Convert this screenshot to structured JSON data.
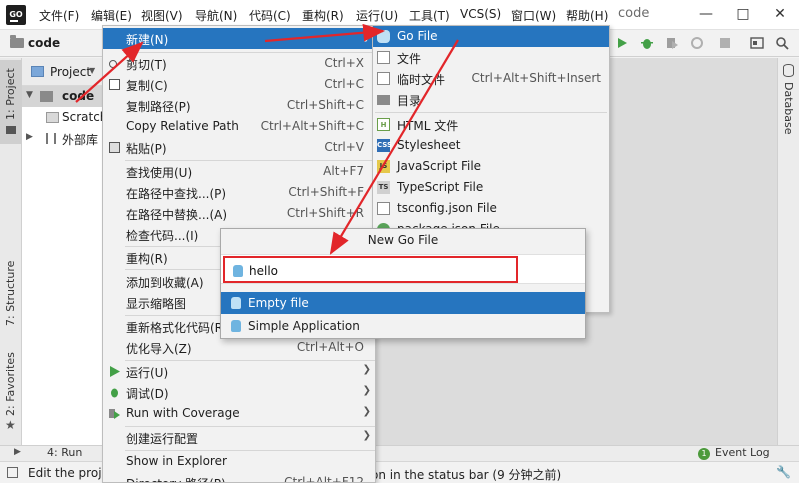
{
  "menubar": {
    "logo": "GO",
    "items": [
      "文件(F)",
      "编辑(E)",
      "视图(V)",
      "导航(N)",
      "代码(C)",
      "重构(R)",
      "运行(U)",
      "工具(T)",
      "VCS(S)",
      "窗口(W)",
      "帮助(H)"
    ],
    "window_title": "code"
  },
  "toolbar": {
    "project_name": "code"
  },
  "left_strip": {
    "tab_project": "1: Project",
    "tab_structure": "7: Structure",
    "tab_favorites": "2: Favorites"
  },
  "right_strip": {
    "tab_database": "Database"
  },
  "project_panel": {
    "header_label": "Project",
    "tree": [
      {
        "label": "code",
        "icon": "folder-icon"
      },
      {
        "label": "Scratch",
        "icon": "scratch-icon"
      },
      {
        "label": "外部库",
        "icon": "library-icon"
      }
    ]
  },
  "context_menu": {
    "items": [
      {
        "label": "新建(N)",
        "shortcut": ""
      },
      {
        "label": "剪切(T)",
        "shortcut": "Ctrl+X"
      },
      {
        "label": "复制(C)",
        "shortcut": "Ctrl+C"
      },
      {
        "label": "复制路径(P)",
        "shortcut": "Ctrl+Shift+C"
      },
      {
        "label": "Copy Relative Path",
        "shortcut": "Ctrl+Alt+Shift+C"
      },
      {
        "label": "粘贴(P)",
        "shortcut": "Ctrl+V"
      },
      {
        "label": "查找使用(U)",
        "shortcut": "Alt+F7"
      },
      {
        "label": "在路径中查找...(P)",
        "shortcut": "Ctrl+Shift+F"
      },
      {
        "label": "在路径中替换...(A)",
        "shortcut": "Ctrl+Shift+R"
      },
      {
        "label": "检查代码...(I)",
        "shortcut": ""
      },
      {
        "label": "重构(R)",
        "shortcut": ""
      },
      {
        "label": "添加到收藏(A)",
        "shortcut": ""
      },
      {
        "label": "显示缩略图",
        "shortcut": ""
      },
      {
        "label": "重新格式化代码(R)",
        "shortcut": ""
      },
      {
        "label": "优化导入(Z)",
        "shortcut": "Ctrl+Alt+O"
      },
      {
        "label": "运行(U)",
        "shortcut": ""
      },
      {
        "label": "调试(D)",
        "shortcut": ""
      },
      {
        "label": "Run with Coverage",
        "shortcut": ""
      },
      {
        "label": "创建运行配置",
        "shortcut": ""
      },
      {
        "label": "Show in Explorer",
        "shortcut": ""
      },
      {
        "label": "Directory 路径(P)",
        "shortcut": "Ctrl+Alt+F12"
      }
    ]
  },
  "new_menu": {
    "items": [
      {
        "label": "Go File",
        "shortcut": "",
        "icon": "go-file-icon"
      },
      {
        "label": "文件",
        "shortcut": "",
        "icon": "file-icon"
      },
      {
        "label": "临时文件",
        "shortcut": "Ctrl+Alt+Shift+Insert",
        "icon": "scratch-file-icon"
      },
      {
        "label": "目录",
        "shortcut": "",
        "icon": "directory-icon"
      },
      {
        "label": "HTML 文件",
        "shortcut": "",
        "icon": "html-icon"
      },
      {
        "label": "Stylesheet",
        "shortcut": "",
        "icon": "css-icon"
      },
      {
        "label": "JavaScript File",
        "shortcut": "",
        "icon": "js-icon"
      },
      {
        "label": "TypeScript File",
        "shortcut": "",
        "icon": "ts-icon"
      },
      {
        "label": "tsconfig.json File",
        "shortcut": "",
        "icon": "tsconfig-icon"
      },
      {
        "label": "package.json File",
        "shortcut": "",
        "icon": "package-json-icon"
      }
    ]
  },
  "new_go_file_dialog": {
    "title": "New Go File",
    "name_value": "hello",
    "kinds": [
      "Empty file",
      "Simple Application"
    ]
  },
  "bottom_bar": {
    "run_tab": "4: Run",
    "event_log": "Event Log"
  },
  "statusbar": {
    "left_text": "Edit the proje",
    "right_text": "on in the status bar (9 分钟之前)"
  },
  "colors": {
    "highlight": "#2675bf",
    "annotation_red": "#e2262a"
  }
}
